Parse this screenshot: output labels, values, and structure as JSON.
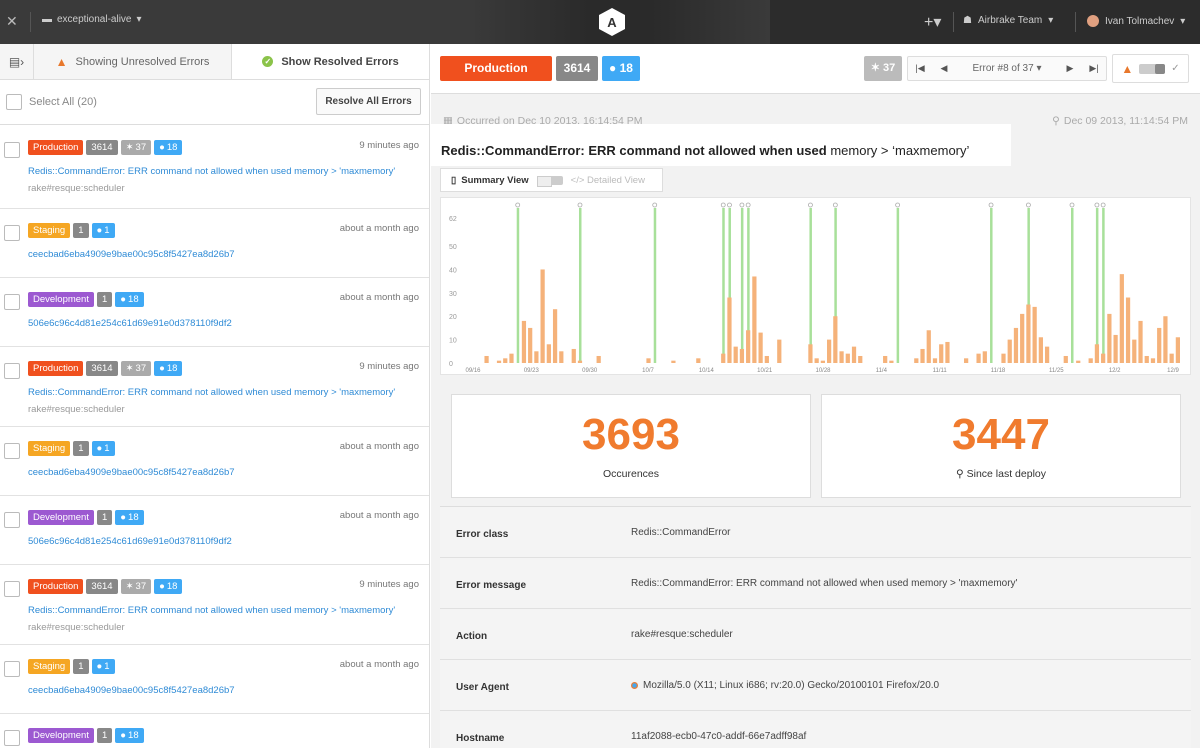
{
  "topbar": {
    "project": "exceptional-alive",
    "logo_letter": "A",
    "team": "Airbrake Team",
    "user": "Ivan Tolmachev"
  },
  "tabs": {
    "unresolved": "Showing Unresolved Errors",
    "resolved": "Show Resolved Errors"
  },
  "selectbar": {
    "select_all": "Select All (20)",
    "resolve_all": "Resolve All Errors"
  },
  "errors": [
    {
      "env": "Production",
      "count": "3614",
      "users": "37",
      "comments": "18",
      "time": "9 minutes ago",
      "message": "Redis::CommandError: ERR command not allowed when used memory > 'maxmemory'",
      "sub": "rake#resque:scheduler"
    },
    {
      "env": "Staging",
      "count": "1",
      "users": "",
      "comments": "1",
      "time": "about a month ago",
      "message": "ceecbad6eba4909e9bae00c95c8f5427ea8d26b7",
      "sub": ""
    },
    {
      "env": "Development",
      "count": "1",
      "users": "",
      "comments": "18",
      "time": "about a month ago",
      "message": "506e6c96c4d81e254c61d69e91e0d378110f9df2",
      "sub": ""
    },
    {
      "env": "Production",
      "count": "3614",
      "users": "37",
      "comments": "18",
      "time": "9 minutes ago",
      "message": "Redis::CommandError: ERR command not allowed when used memory > 'maxmemory'",
      "sub": "rake#resque:scheduler"
    },
    {
      "env": "Staging",
      "count": "1",
      "users": "",
      "comments": "1",
      "time": "about a month ago",
      "message": "ceecbad6eba4909e9bae00c95c8f5427ea8d26b7",
      "sub": ""
    },
    {
      "env": "Development",
      "count": "1",
      "users": "",
      "comments": "18",
      "time": "about a month ago",
      "message": "506e6c96c4d81e254c61d69e91e0d378110f9df2",
      "sub": ""
    },
    {
      "env": "Production",
      "count": "3614",
      "users": "37",
      "comments": "18",
      "time": "9 minutes ago",
      "message": "Redis::CommandError: ERR command not allowed when used memory > 'maxmemory'",
      "sub": "rake#resque:scheduler"
    },
    {
      "env": "Staging",
      "count": "1",
      "users": "",
      "comments": "1",
      "time": "about a month ago",
      "message": "ceecbad6eba4909e9bae00c95c8f5427ea8d26b7",
      "sub": ""
    },
    {
      "env": "Development",
      "count": "1",
      "users": "",
      "comments": "18",
      "time": "",
      "message": "",
      "sub": ""
    }
  ],
  "detail": {
    "env": "Production",
    "count": "3614",
    "comments": "18",
    "users": "37",
    "pager": "Error #8 of 37",
    "occurred": "Occurred on Dec 10 2013, 16:14:54 PM",
    "deployed": "Dec 09 2013, 11:14:54 PM",
    "title_prefix": "Redis::CommandError: ERR command not allowed when used",
    "title_suffix": "memory > ‘maxmemory’",
    "summary_view": "Summary View",
    "detailed_view": "</> Detailed View"
  },
  "stats": {
    "occurrences": "3693",
    "occurrences_label": "Occurences",
    "since_deploy": "3447",
    "since_deploy_label": "Since last deploy"
  },
  "fields": [
    {
      "key": "Error class",
      "value": "Redis::CommandError"
    },
    {
      "key": "Error message",
      "value": "Redis::CommandError: ERR command not allowed when used memory > 'maxmemory'"
    },
    {
      "key": "Action",
      "value": "rake#resque:scheduler"
    },
    {
      "key": "User Agent",
      "value": "Mozilla/5.0 (X11; Linux i686; rv:20.0) Gecko/20100101 Firefox/20.0"
    },
    {
      "key": "Hostname",
      "value": "11af2088-ecb0-47c0-addf-66e7adff98af"
    }
  ],
  "chart_data": {
    "type": "bar",
    "y_ticks": [
      "62",
      "50",
      "40",
      "30",
      "20",
      "10",
      "0"
    ],
    "x_ticks": [
      "09/16",
      "09/23",
      "09/30",
      "10/7",
      "10/14",
      "10/21",
      "10/28",
      "11/4",
      "11/11",
      "11/18",
      "11/25",
      "12/2",
      "12/9"
    ],
    "ylim": [
      0,
      62
    ],
    "deploy_days": [
      7,
      17,
      29,
      40,
      41,
      43,
      44,
      54,
      58,
      68,
      83,
      89,
      96,
      100,
      101
    ],
    "values": [
      0,
      0,
      3,
      0,
      1,
      2,
      4,
      0,
      18,
      15,
      5,
      40,
      8,
      23,
      5,
      0,
      6,
      1,
      0,
      0,
      3,
      0,
      0,
      0,
      0,
      0,
      0,
      0,
      2,
      0,
      0,
      0,
      1,
      0,
      0,
      0,
      2,
      0,
      0,
      0,
      4,
      28,
      7,
      6,
      14,
      37,
      13,
      3,
      0,
      10,
      0,
      0,
      0,
      0,
      8,
      2,
      1,
      10,
      20,
      5,
      4,
      7,
      3,
      0,
      0,
      0,
      3,
      1,
      0,
      0,
      0,
      2,
      6,
      14,
      2,
      8,
      9,
      0,
      0,
      2,
      0,
      4,
      5,
      0,
      0,
      4,
      10,
      15,
      21,
      25,
      24,
      11,
      7,
      0,
      0,
      3,
      0,
      1,
      0,
      2,
      8,
      4,
      21,
      12,
      38,
      28,
      10,
      18,
      3,
      2,
      15,
      20,
      4,
      11
    ]
  },
  "colors": {
    "production": "#f0501e",
    "staging": "#f5a623",
    "development": "#9c59d1",
    "comment": "#3fa9f5",
    "bar": "#f5b27a",
    "deploy": "#a8e09a",
    "stat": "#f07b2e"
  }
}
